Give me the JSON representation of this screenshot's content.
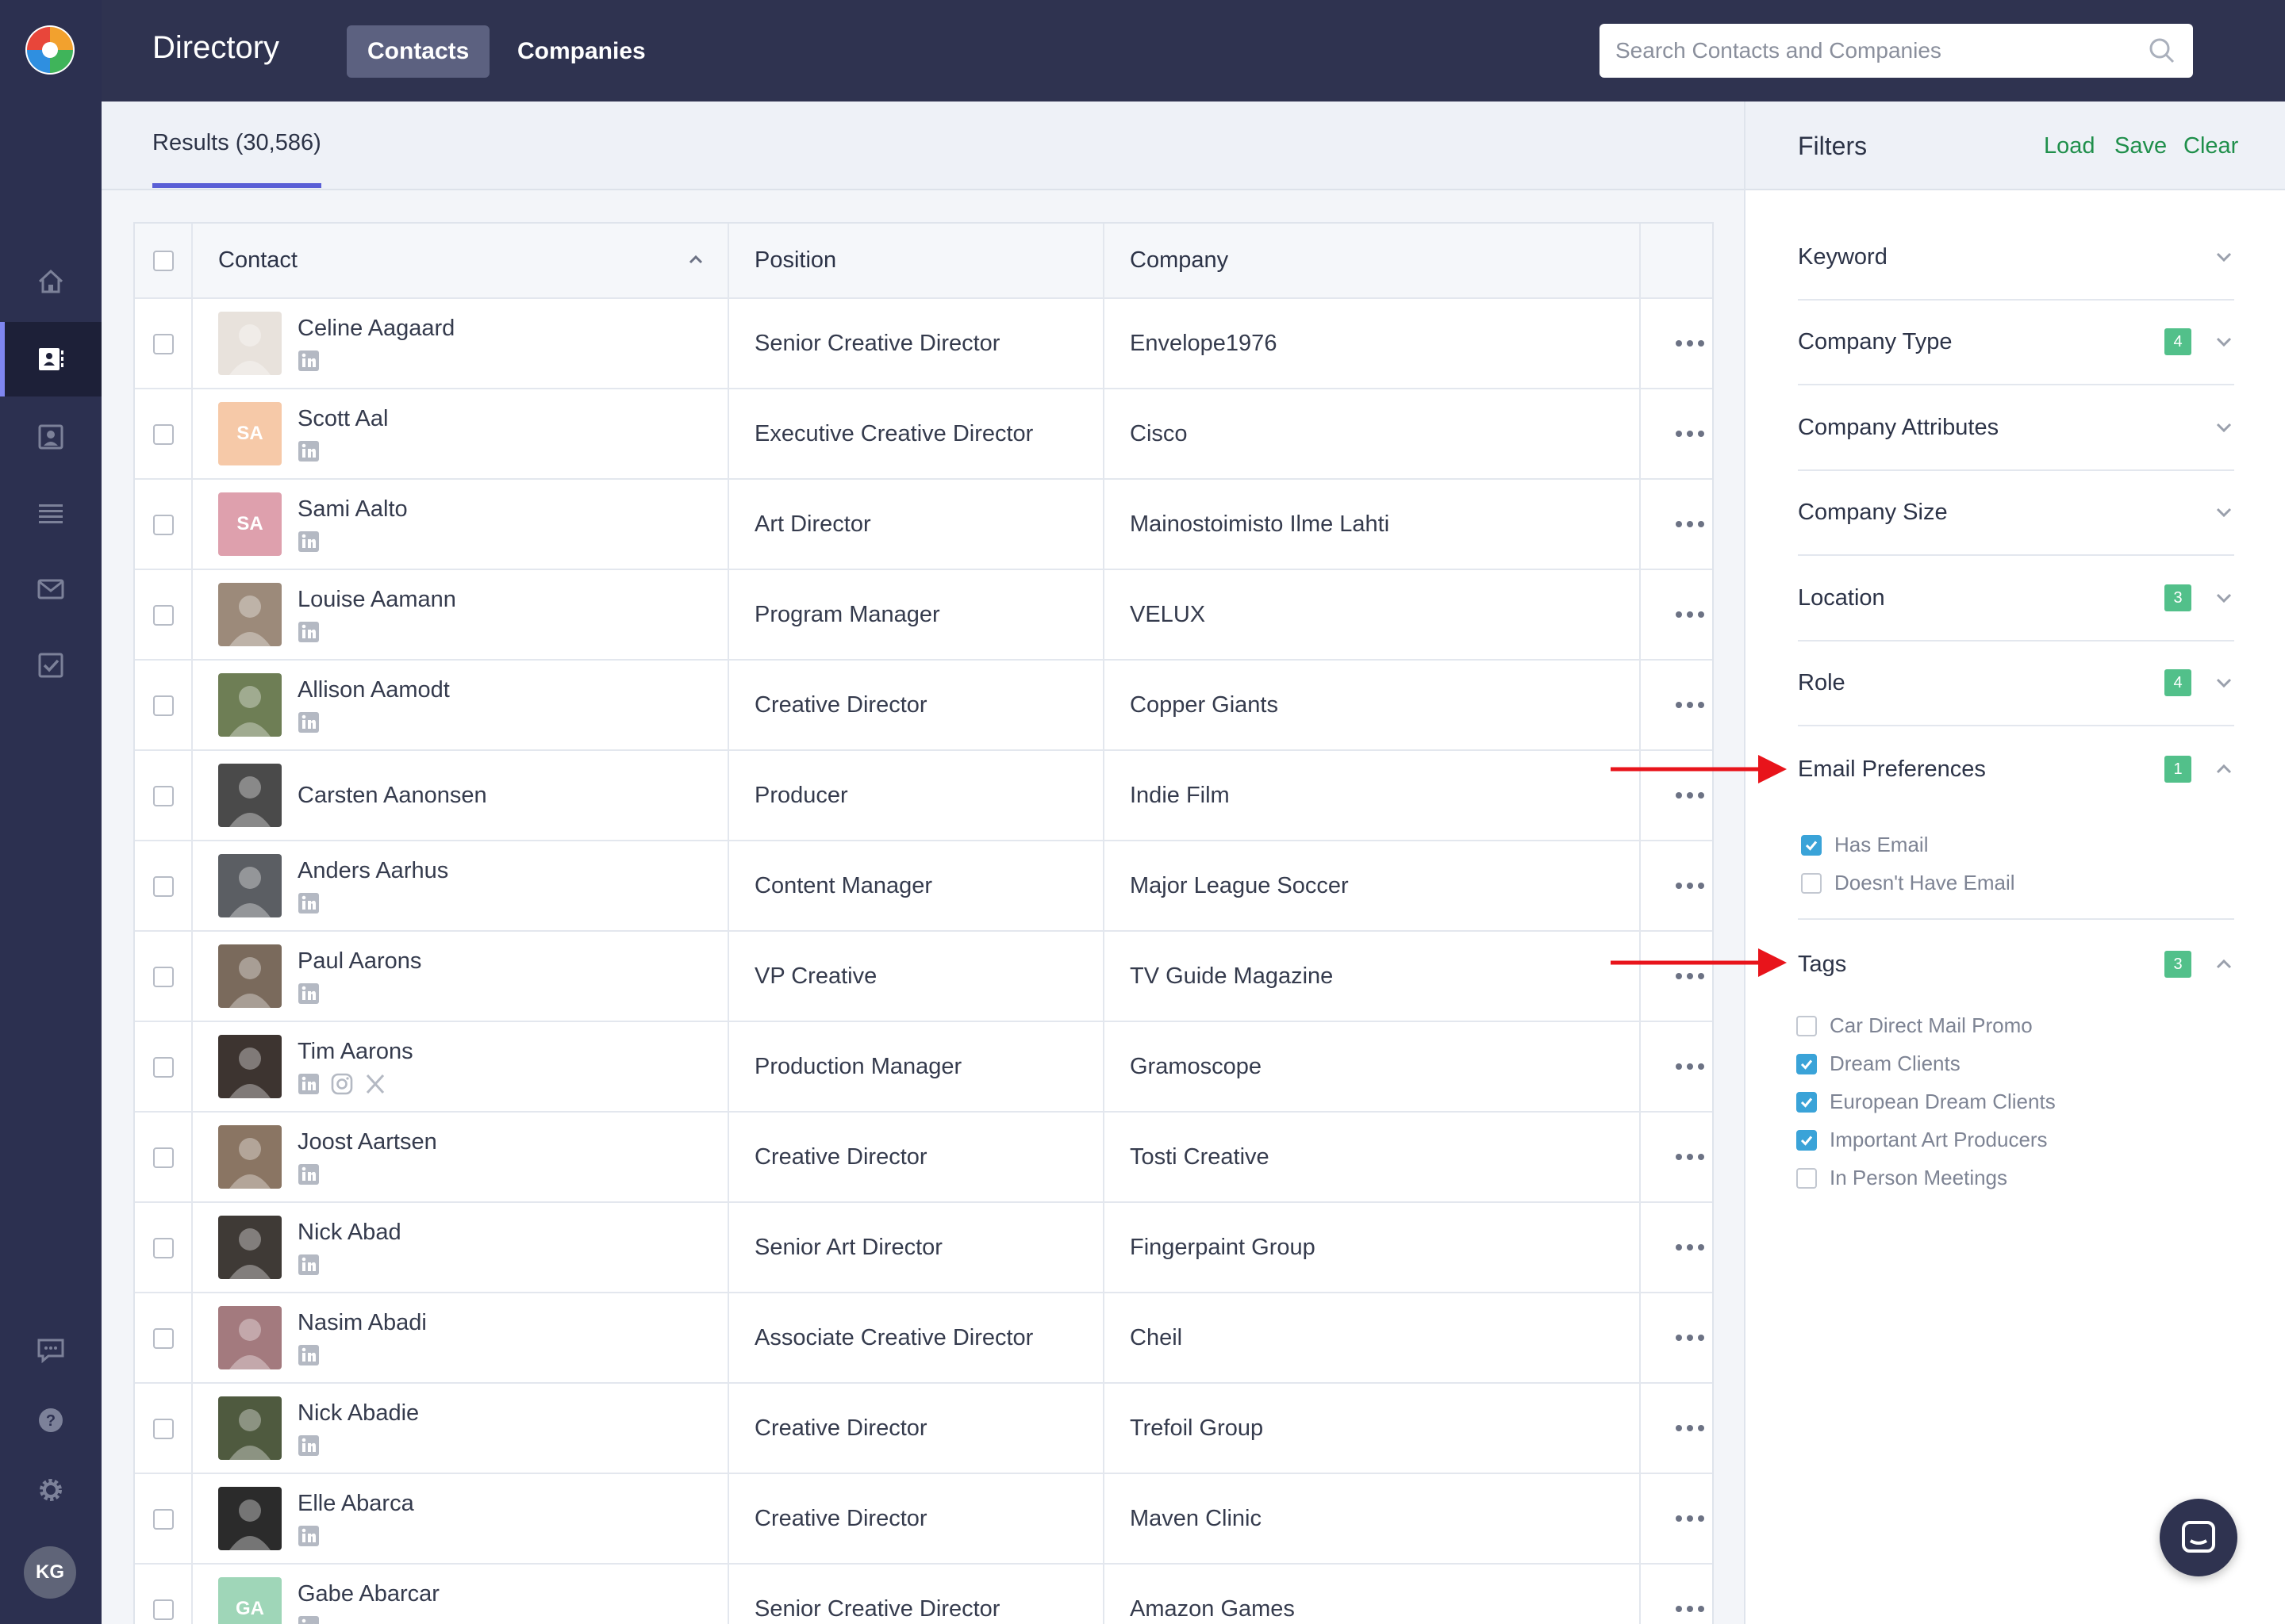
{
  "app": {
    "title": "Directory",
    "tabs": [
      {
        "label": "Contacts",
        "active": true
      },
      {
        "label": "Companies",
        "active": false
      }
    ],
    "search_placeholder": "Search Contacts and Companies",
    "user_initials": "KG"
  },
  "rail": {
    "items": [
      {
        "icon": "home-icon"
      },
      {
        "icon": "contacts-book-icon",
        "active": true
      },
      {
        "icon": "person-card-icon"
      },
      {
        "icon": "list-icon"
      },
      {
        "icon": "mail-icon"
      },
      {
        "icon": "checkbox-icon"
      },
      {
        "icon": "chat-bubble-icon"
      },
      {
        "icon": "help-icon"
      },
      {
        "icon": "gear-icon"
      }
    ]
  },
  "results": {
    "label": "Results (30,586)"
  },
  "table": {
    "columns": [
      "Contact",
      "Position",
      "Company"
    ],
    "rows": [
      {
        "name": "Celine Aagaard",
        "position": "Senior Creative Director",
        "company": "Envelope1976",
        "avatar_color": "#e8e2dc",
        "initials": "",
        "socials": [
          "linkedin"
        ]
      },
      {
        "name": "Scott Aal",
        "position": "Executive Creative Director",
        "company": "Cisco",
        "avatar_color": "#f6c9a8",
        "initials": "SA",
        "socials": [
          "linkedin"
        ]
      },
      {
        "name": "Sami Aalto",
        "position": "Art Director",
        "company": "Mainostoimisto Ilme Lahti",
        "avatar_color": "#dea0ad",
        "initials": "SA",
        "socials": [
          "linkedin"
        ]
      },
      {
        "name": "Louise Aamann",
        "position": "Program Manager",
        "company": "VELUX",
        "avatar_color": "#9c8a7a",
        "initials": "",
        "socials": [
          "linkedin"
        ]
      },
      {
        "name": "Allison Aamodt",
        "position": "Creative Director",
        "company": "Copper Giants",
        "avatar_color": "#6e7e55",
        "initials": "",
        "socials": [
          "linkedin"
        ]
      },
      {
        "name": "Carsten Aanonsen",
        "position": "Producer",
        "company": "Indie Film",
        "avatar_color": "#4a4a4a",
        "initials": "",
        "socials": []
      },
      {
        "name": "Anders Aarhus",
        "position": "Content Manager",
        "company": "Major League Soccer",
        "avatar_color": "#5b5e63",
        "initials": "",
        "socials": [
          "linkedin"
        ]
      },
      {
        "name": "Paul Aarons",
        "position": "VP Creative",
        "company": "TV Guide Magazine",
        "avatar_color": "#7a6a5c",
        "initials": "",
        "socials": [
          "linkedin"
        ]
      },
      {
        "name": "Tim Aarons",
        "position": "Production Manager",
        "company": "Gramoscope",
        "avatar_color": "#3d3430",
        "initials": "",
        "socials": [
          "linkedin",
          "instagram",
          "x"
        ]
      },
      {
        "name": "Joost Aartsen",
        "position": "Creative Director",
        "company": "Tosti Creative",
        "avatar_color": "#8a7563",
        "initials": "",
        "socials": [
          "linkedin"
        ]
      },
      {
        "name": "Nick Abad",
        "position": "Senior Art Director",
        "company": "Fingerpaint Group",
        "avatar_color": "#3f3a36",
        "initials": "",
        "socials": [
          "linkedin"
        ]
      },
      {
        "name": "Nasim Abadi",
        "position": "Associate Creative Director",
        "company": "Cheil",
        "avatar_color": "#a37a7e",
        "initials": "",
        "socials": [
          "linkedin"
        ]
      },
      {
        "name": "Nick Abadie",
        "position": "Creative Director",
        "company": "Trefoil Group",
        "avatar_color": "#4f5a3f",
        "initials": "",
        "socials": [
          "linkedin"
        ]
      },
      {
        "name": "Elle Abarca",
        "position": "Creative Director",
        "company": "Maven Clinic",
        "avatar_color": "#2b2b2b",
        "initials": "",
        "socials": [
          "linkedin"
        ]
      },
      {
        "name": "Gabe Abarcar",
        "position": "Senior Creative Director",
        "company": "Amazon Games",
        "avatar_color": "#9fd6b8",
        "initials": "GA",
        "socials": [
          "linkedin"
        ]
      }
    ]
  },
  "filters": {
    "title": "Filters",
    "actions": [
      "Load",
      "Save",
      "Clear"
    ],
    "sections": [
      {
        "label": "Keyword",
        "badge": "",
        "expanded": false
      },
      {
        "label": "Company Type",
        "badge": "4",
        "expanded": false
      },
      {
        "label": "Company Attributes",
        "badge": "",
        "expanded": false
      },
      {
        "label": "Company Size",
        "badge": "",
        "expanded": false
      },
      {
        "label": "Location",
        "badge": "3",
        "expanded": false
      },
      {
        "label": "Role",
        "badge": "4",
        "expanded": false
      },
      {
        "label": "Email Preferences",
        "badge": "1",
        "expanded": true
      },
      {
        "label": "Tags",
        "badge": "3",
        "expanded": true
      }
    ],
    "email_options": [
      {
        "label": "Has Email",
        "checked": true
      },
      {
        "label": "Doesn't Have Email",
        "checked": false
      }
    ],
    "tag_options": [
      {
        "label": "Car Direct Mail Promo",
        "checked": false
      },
      {
        "label": "Dream Clients",
        "checked": true
      },
      {
        "label": "European Dream Clients",
        "checked": true
      },
      {
        "label": "Important Art Producers",
        "checked": true
      },
      {
        "label": "In Person Meetings",
        "checked": false
      }
    ]
  },
  "colors": {
    "accent": "#5a5fd6",
    "action_green": "#1f8f4b",
    "badge_green": "#52c08a",
    "annotation_red": "#e8141b",
    "check_blue": "#3aa3d8"
  }
}
